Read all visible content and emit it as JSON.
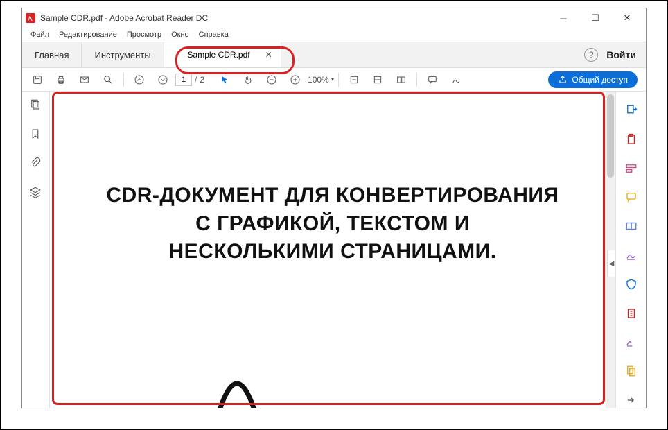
{
  "window": {
    "title": "Sample CDR.pdf - Adobe Acrobat Reader DC"
  },
  "menu": {
    "file": "Файл",
    "edit": "Редактирование",
    "view": "Просмотр",
    "window": "Окно",
    "help": "Справка"
  },
  "tabs": {
    "home": "Главная",
    "tools": "Инструменты",
    "doc": "Sample CDR.pdf"
  },
  "topright": {
    "login": "Войти",
    "help": "?"
  },
  "toolbar": {
    "page_current": "1",
    "page_sep": "/",
    "page_total": "2",
    "zoom": "100%",
    "share": "Общий доступ"
  },
  "document": {
    "line1": "CDR-ДОКУМЕНТ ДЛЯ КОНВЕРТИРОВАНИЯ",
    "line2": "С ГРАФИКОЙ, ТЕКСТОМ И",
    "line3": "НЕСКОЛЬКИМИ СТРАНИЦАМИ."
  }
}
